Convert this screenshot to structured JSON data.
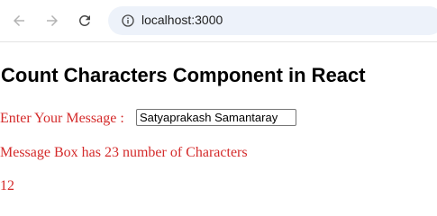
{
  "browser": {
    "url": "localhost:3000",
    "icons": {
      "back": "back-arrow-icon",
      "forward": "forward-arrow-icon",
      "reload": "reload-icon",
      "site_info": "info-icon"
    }
  },
  "page": {
    "heading": "Count Characters Component in React",
    "input_label": "Enter Your Message :",
    "input_value": "Satyaprakash Samantaray",
    "count_text": "Message Box has 23 number of Characters",
    "number": "12"
  },
  "colors": {
    "text_accent": "#d42a2a",
    "omnibox_bg": "#edf2fa"
  }
}
